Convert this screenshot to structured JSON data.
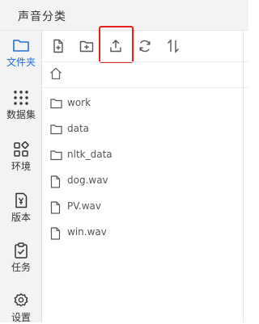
{
  "header": {
    "title": "声音分类"
  },
  "sidebar": {
    "items": [
      {
        "label": "文件夹",
        "icon": "folder-icon",
        "active": true
      },
      {
        "label": "数据集",
        "icon": "dataset-grid-icon"
      },
      {
        "label": "环境",
        "icon": "environment-icon"
      },
      {
        "label": "版本",
        "icon": "version-icon"
      },
      {
        "label": "任务",
        "icon": "task-clipboard-icon"
      },
      {
        "label": "设置",
        "icon": "settings-gear-icon"
      }
    ]
  },
  "toolbar": {
    "buttons": [
      {
        "icon": "new-file-icon"
      },
      {
        "icon": "new-folder-icon"
      },
      {
        "icon": "upload-icon",
        "highlighted": true
      },
      {
        "icon": "refresh-icon"
      },
      {
        "icon": "sort-icon"
      }
    ],
    "highlight_color": "#e8201e"
  },
  "breadcrumb": {
    "icon": "home-icon"
  },
  "files": [
    {
      "name": "work",
      "type": "folder"
    },
    {
      "name": "data",
      "type": "folder"
    },
    {
      "name": "nltk_data",
      "type": "folder"
    },
    {
      "name": "dog.wav",
      "type": "file"
    },
    {
      "name": "PV.wav",
      "type": "file"
    },
    {
      "name": "win.wav",
      "type": "file"
    }
  ],
  "colors": {
    "accent": "#1f6fd6",
    "sidebar_bg": "#f3f3f3"
  }
}
